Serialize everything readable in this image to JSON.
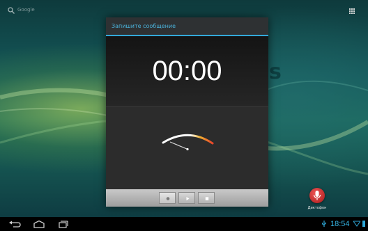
{
  "home_screen": {
    "search_label": "Google",
    "background_word": "s"
  },
  "dialog": {
    "title": "Запишите сообщение",
    "timer": "00:00"
  },
  "controls": {
    "record_icon": "record-icon",
    "play_icon": "play-icon",
    "stop_icon": "stop-icon"
  },
  "desktop_app": {
    "label": "Диктофон",
    "icon": "microphone-icon"
  },
  "status_bar": {
    "time": "18:54"
  },
  "colors": {
    "accent": "#33a9d9",
    "clock": "#35b5e5",
    "meter_hot": "#e8452a"
  }
}
